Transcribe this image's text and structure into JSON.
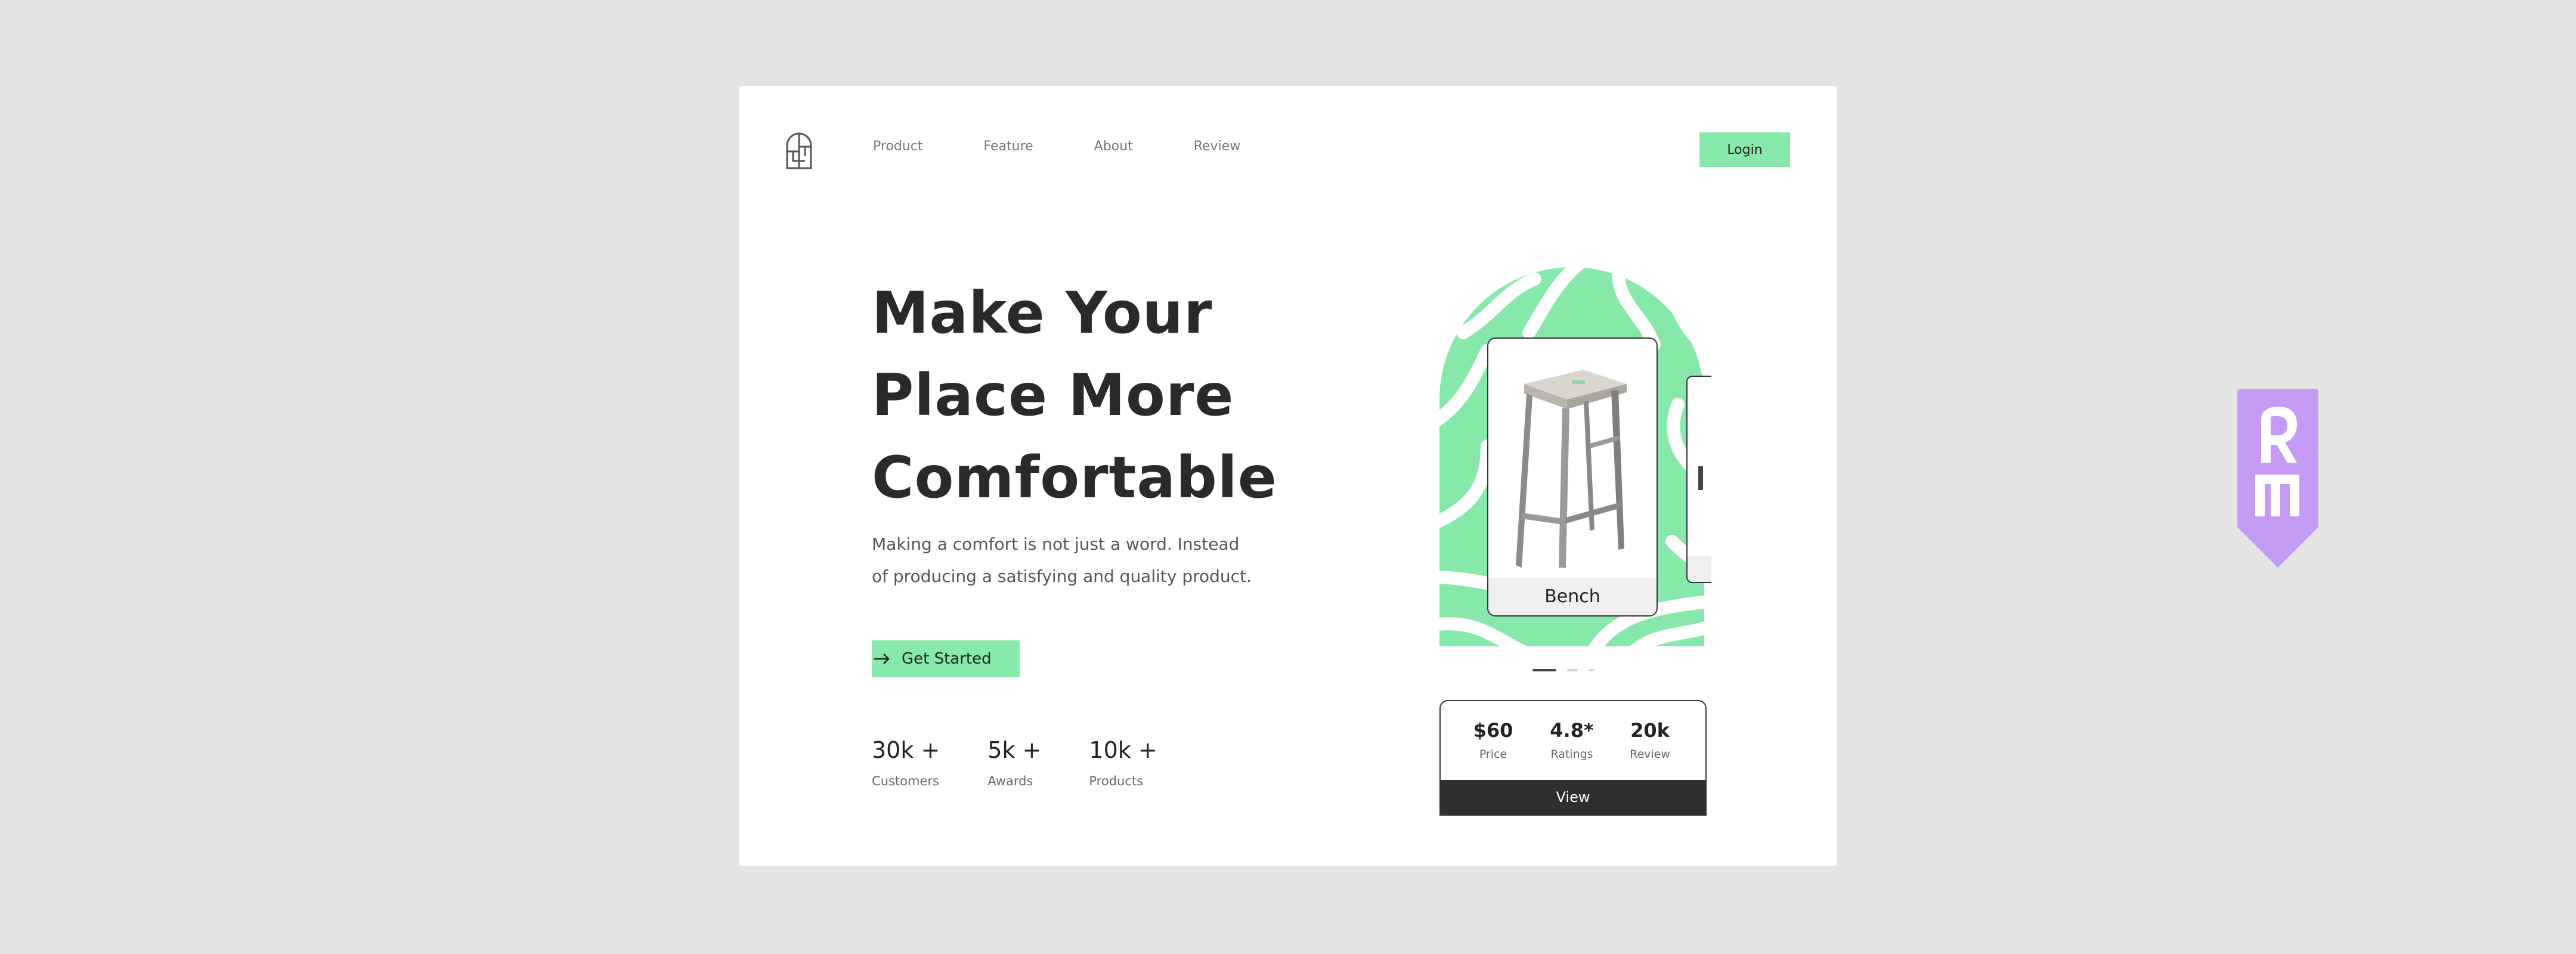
{
  "nav": {
    "items": [
      {
        "label": "Product"
      },
      {
        "label": "Feature"
      },
      {
        "label": "About"
      },
      {
        "label": "Review"
      }
    ],
    "login_label": "Login"
  },
  "hero": {
    "title_lines": [
      "Make Your",
      "Place More",
      "Comfortable"
    ],
    "subtitle_lines": [
      "Making a comfort is not just a word. Instead",
      "of producing a satisfying and quality product."
    ],
    "cta_label": "Get Started"
  },
  "stats": [
    {
      "value": "30k +",
      "label": "Customers"
    },
    {
      "value": "5k +",
      "label": "Awards"
    },
    {
      "value": "10k +",
      "label": "Products"
    }
  ],
  "product": {
    "name": "Bench",
    "price": "$60",
    "price_label": "Price",
    "rating": "4.8*",
    "rating_label": "Ratings",
    "reviews": "20k",
    "reviews_label": "Review",
    "view_label": "View"
  },
  "carousel": {
    "active_index": 0,
    "count": 3
  },
  "colors": {
    "accent": "#86e9aa",
    "dark": "#2f2f2f",
    "badge": "#c49af5",
    "background": "#e3e4e3"
  },
  "icons": [
    "logo-icon",
    "arrow-right-icon",
    "stool-image",
    "brand-badge-icon"
  ]
}
